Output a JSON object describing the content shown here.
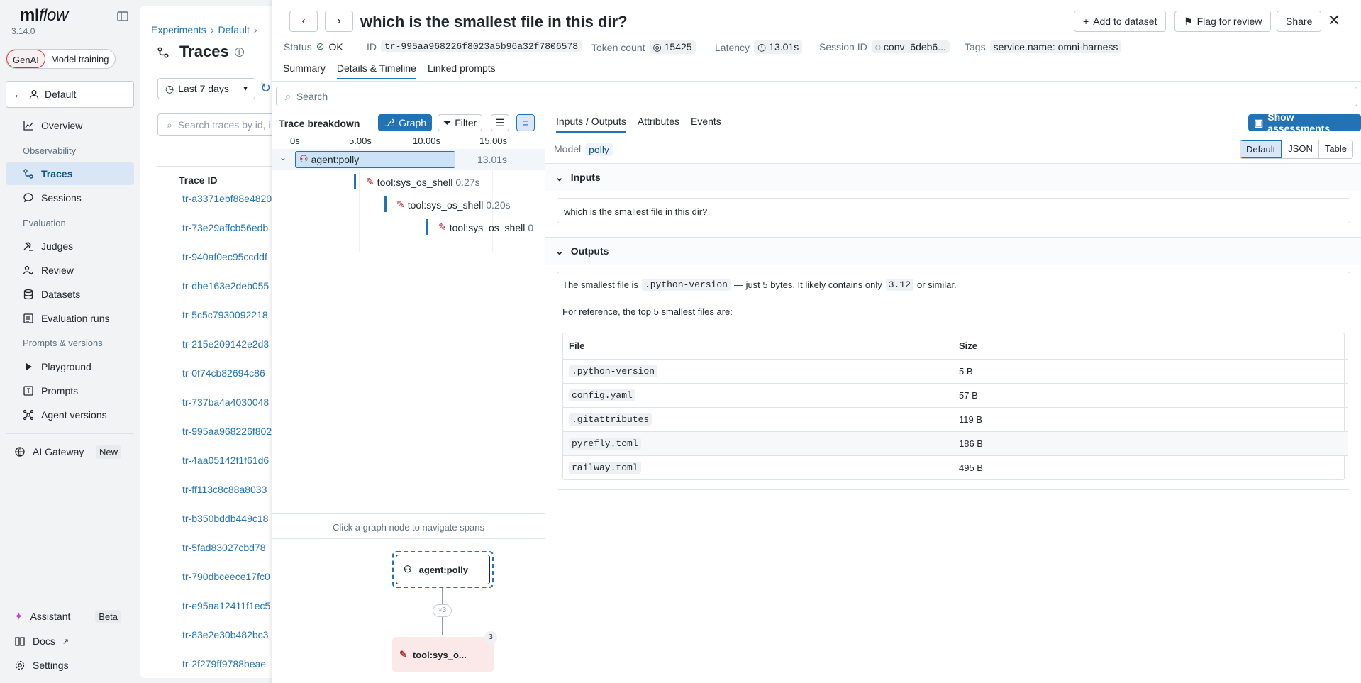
{
  "app": {
    "logo_prefix": "ml",
    "logo_italic": "flow",
    "version": "3.14.0"
  },
  "mode": {
    "genai": "GenAI",
    "training": "Model training"
  },
  "workspace": "Default",
  "sidebar": {
    "overview": "Overview",
    "section_observability": "Observability",
    "traces": "Traces",
    "sessions": "Sessions",
    "section_evaluation": "Evaluation",
    "judges": "Judges",
    "review": "Review",
    "datasets": "Datasets",
    "evaluation_runs": "Evaluation runs",
    "section_prompts": "Prompts & versions",
    "playground": "Playground",
    "prompts": "Prompts",
    "agent_versions": "Agent versions",
    "ai_gateway": "AI Gateway",
    "ai_gateway_badge": "New",
    "assistant": "Assistant",
    "assistant_badge": "Beta",
    "docs": "Docs",
    "settings": "Settings"
  },
  "breadcrumb": {
    "experiments": "Experiments",
    "default": "Default",
    "sep": "›"
  },
  "page_title": "Traces",
  "time_filter": "Last 7 days",
  "trace_search_placeholder": "Search traces by id, i",
  "table_header": "Trace ID",
  "trace_rows": [
    "tr-a3371ebf88e4820",
    "tr-73e29affcb56edb",
    "tr-940af0ec95ccddf",
    "tr-dbe163e2deb055",
    "tr-5c5c7930092218",
    "tr-215e209142e2d3",
    "tr-0f74cb82694c86",
    "tr-737ba4a4030048",
    "tr-995aa968226f802",
    "tr-4aa05142f1f61d6",
    "tr-ff113c8c88a8033",
    "tr-b350bddb449c18",
    "tr-5fad83027cbd78",
    "tr-790dbceece17fc0",
    "tr-e95aa12411f1ec5",
    "tr-83e2e30b482bc3",
    "tr-2f279ff9788beae"
  ],
  "drawer": {
    "title": "which is the smallest file in this dir?",
    "add_to_dataset": "Add to dataset",
    "flag_for_review": "Flag for review",
    "share": "Share",
    "status_label": "Status",
    "status_value": "OK",
    "id_label": "ID",
    "id_value": "tr-995aa968226f8023a5b96a32f7806578",
    "token_label": "Token count",
    "token_value": "15425",
    "latency_label": "Latency",
    "latency_value": "13.01s",
    "session_label": "Session ID",
    "session_value": "conv_6deb6...",
    "tags_label": "Tags",
    "tag_value": "service.name: omni-harness",
    "tabs": [
      "Summary",
      "Details & Timeline",
      "Linked prompts"
    ],
    "search_placeholder": "Search"
  },
  "breakdown": {
    "title": "Trace breakdown",
    "graph_btn": "Graph",
    "filter_btn": "Filter",
    "axis": [
      "0s",
      "5.00s",
      "10.00s",
      "15.00s"
    ],
    "root_span": "agent:polly",
    "root_duration": "13.01s",
    "spans": [
      {
        "name": "tool:sys_os_shell",
        "duration": "0.27s"
      },
      {
        "name": "tool:sys_os_shell",
        "duration": "0.20s"
      },
      {
        "name": "tool:sys_os_shell",
        "duration": "0"
      }
    ],
    "hint": "Click a graph node to navigate spans",
    "graph_root": "agent:polly",
    "graph_edge": "×3",
    "graph_child": "tool:sys_o...",
    "graph_count": "3"
  },
  "detail": {
    "tabs": [
      "Inputs / Outputs",
      "Attributes",
      "Events"
    ],
    "show_assessments": "Show assessments",
    "model_label": "Model",
    "model_value": "polly",
    "views": [
      "Default",
      "JSON",
      "Table"
    ],
    "inputs_label": "Inputs",
    "input_text": "which is the smallest file in this dir?",
    "outputs_label": "Outputs",
    "out_pre": "The smallest file is",
    "out_file": ".python-version",
    "out_mid": "— just 5 bytes. It likely contains only",
    "out_ver": "3.12",
    "out_post": "or similar.",
    "out_ref": "For reference, the top 5 smallest files are:",
    "col_file": "File",
    "col_size": "Size",
    "files": [
      {
        "name": ".python-version",
        "size": "5 B"
      },
      {
        "name": "config.yaml",
        "size": "57 B"
      },
      {
        "name": ".gitattributes",
        "size": "119 B"
      },
      {
        "name": "pyrefly.toml",
        "size": "186 B"
      },
      {
        "name": "railway.toml",
        "size": "495 B"
      }
    ]
  },
  "colors": {
    "accent": "#2272b4",
    "ok": "#277c43",
    "tool": "#b3262b",
    "brand_red": "#e02d2d"
  }
}
